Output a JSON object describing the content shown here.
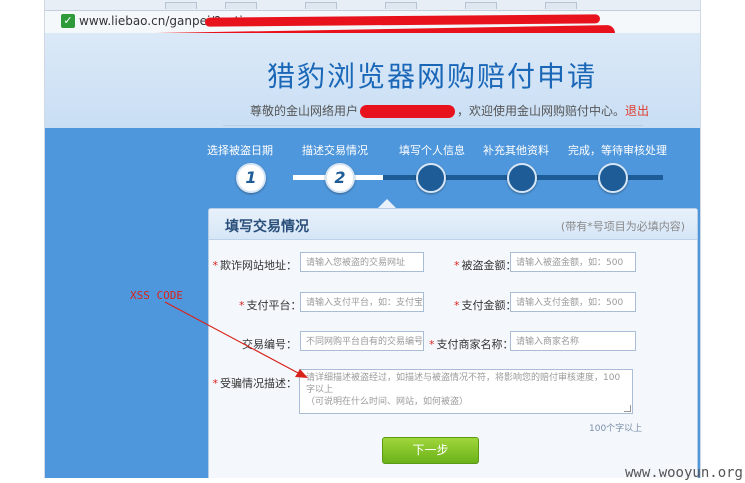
{
  "browser": {
    "url": "www.liebao.cn/ganpei/?acti"
  },
  "header": {
    "title": "猎豹浏览器网购赔付申请",
    "welcome_prefix": "尊敬的金山网络用户",
    "welcome_suffix": "，欢迎使用金山网购赔付中心。",
    "logout": "退出"
  },
  "steps": [
    {
      "label": "选择被盗日期",
      "number": "1",
      "done": true
    },
    {
      "label": "描述交易情况",
      "number": "2",
      "done": true
    },
    {
      "label": "填写个人信息",
      "number": "",
      "done": false
    },
    {
      "label": "补充其他资料",
      "number": "",
      "done": false
    },
    {
      "label": "完成，等待审核处理",
      "number": "",
      "done": false
    }
  ],
  "form": {
    "title": "填写交易情况",
    "note": "(带有*号项目为必填内容)",
    "fields": {
      "fraud_site": {
        "label": "欺诈网站地址：",
        "required": true,
        "placeholder": "请输入您被盗的交易网址"
      },
      "stolen_amount": {
        "label": "被盗金额：",
        "required": true,
        "placeholder": "请输入被盗金额，如：500"
      },
      "pay_platform": {
        "label": "支付平台：",
        "required": true,
        "placeholder": "请输入支付平台，如：支付宝"
      },
      "pay_amount": {
        "label": "支付金额：",
        "required": true,
        "placeholder": "请输入支付金额，如：500"
      },
      "trade_no": {
        "label": "交易编号：",
        "required": false,
        "placeholder": "不同网购平台自有的交易编号"
      },
      "merchant_name": {
        "label": "支付商家名称：",
        "required": true,
        "placeholder": "请输入商家名称"
      },
      "description": {
        "label": "受骗情况描述：",
        "required": true,
        "placeholder_line1": "请详细描述被盗经过，如描述与被盗情况不符，将影响您的赔付审核速度，100字以上",
        "placeholder_line2": "（可说明在什么时间、网站，如何被盗）"
      }
    },
    "limit_hint": "100个字以上",
    "next_button": "下一步"
  },
  "annotation": {
    "xss_label": "XSS CODE"
  },
  "watermark": "www.wooyun.org",
  "colors": {
    "page_blue": "#4f97dc",
    "title_blue": "#1a67b8",
    "required_red": "#d9241c",
    "scribble_red": "#e8121c",
    "button_green": "#6bb21a"
  }
}
